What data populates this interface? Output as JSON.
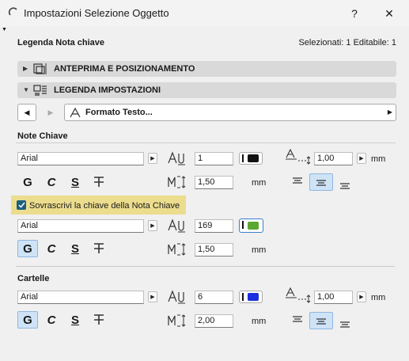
{
  "window": {
    "title": "Impostazioni Selezione Oggetto",
    "help_label": "?",
    "close_label": "✕"
  },
  "header": {
    "name": "Legenda Nota chiave",
    "selection_info": "Selezionati: 1 Editabile: 1"
  },
  "sections": {
    "preview": {
      "label": "ANTEPRIMA E POSIZIONAMENTO"
    },
    "legend": {
      "label": "LEGENDA IMPOSTAZIONI"
    }
  },
  "nav": {
    "panel_label": "Formato Testo..."
  },
  "note_chiave": {
    "title": "Note Chiave",
    "font": "Arial",
    "size": "1",
    "pen_color": "#111111",
    "line_spacing": "1,50",
    "line_spacing_unit": "mm",
    "width_factor": "1,00",
    "width_factor_unit": "mm"
  },
  "override": {
    "label": "Sovrascrivi la chiave della Nota Chiave",
    "checked": true,
    "font": "Arial",
    "size": "169",
    "pen_color": "#5aa832",
    "line_spacing": "1,50",
    "line_spacing_unit": "mm"
  },
  "cartelle": {
    "title": "Cartelle",
    "font": "Arial",
    "size": "6",
    "pen_color": "#1a2ee0",
    "line_spacing": "2,00",
    "line_spacing_unit": "mm",
    "width_factor": "1,00",
    "width_factor_unit": "mm"
  },
  "styles": {
    "bold": "G",
    "italic": "C",
    "underline": "S",
    "strike": "T"
  }
}
